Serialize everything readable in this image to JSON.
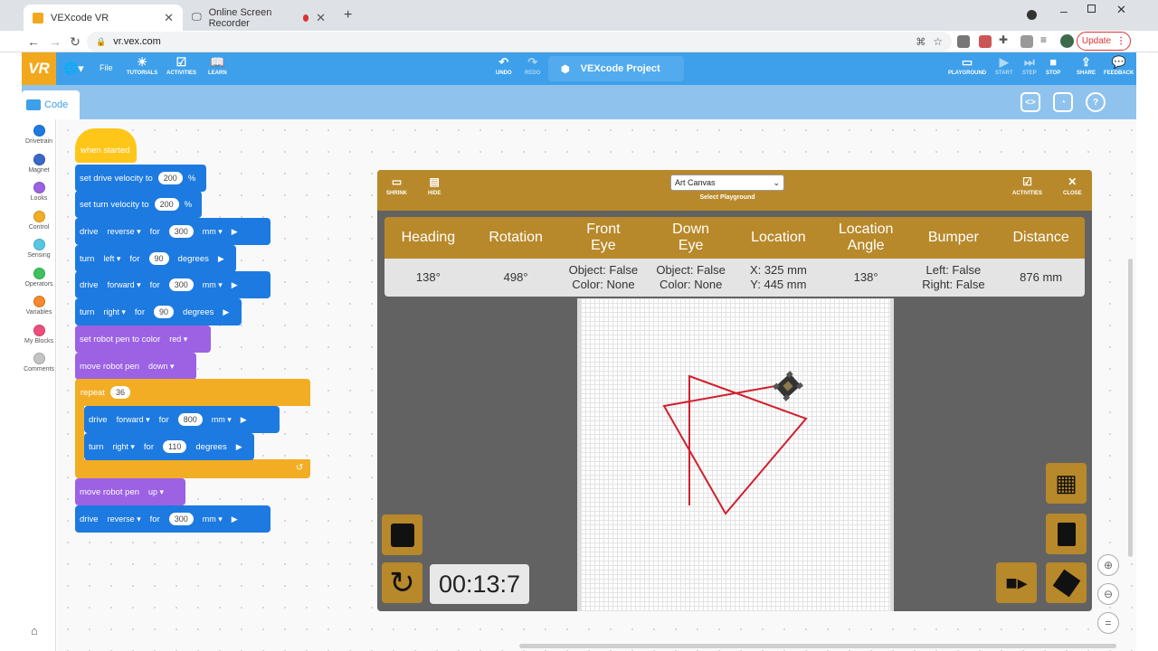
{
  "browser": {
    "tabs": [
      {
        "title": "VEXcode VR"
      },
      {
        "title": "Online Screen Recorder"
      }
    ],
    "url": "vr.vex.com",
    "update_label": "Update"
  },
  "vex": {
    "logo": "VR",
    "file_label": "File",
    "toolbar": {
      "tutorials": "TUTORIALS",
      "activities": "ACTIVITIES",
      "learn": "LEARN",
      "undo": "UNDO",
      "redo": "REDO",
      "playground": "PLAYGROUND",
      "start": "START",
      "step": "STEP",
      "stop": "STOP",
      "share": "SHARE",
      "feedback": "FEEDBACK"
    },
    "project_name": "VEXcode Project",
    "code_tab": "Code"
  },
  "categories": [
    {
      "label": "Drivetrain",
      "color": "#1d7ae0"
    },
    {
      "label": "Magnet",
      "color": "#3a67c9"
    },
    {
      "label": "Looks",
      "color": "#9c62e3"
    },
    {
      "label": "Control",
      "color": "#f2ad24"
    },
    {
      "label": "Sensing",
      "color": "#57c6e3"
    },
    {
      "label": "Operators",
      "color": "#3fc25a"
    },
    {
      "label": "Variables",
      "color": "#f5892b"
    },
    {
      "label": "My Blocks",
      "color": "#ee4d7e"
    },
    {
      "label": "Comments",
      "color": "#c4c4c4"
    }
  ],
  "blocks": {
    "hat": "when started",
    "b1": {
      "text": "set drive velocity to",
      "value": "200",
      "unit": "%"
    },
    "b2": {
      "text": "set turn velocity to",
      "value": "200",
      "unit": "%"
    },
    "b3": {
      "cmd": "drive",
      "dir": "reverse",
      "for": "for",
      "value": "300",
      "unit": "mm"
    },
    "b4": {
      "cmd": "turn",
      "dir": "left",
      "for": "for",
      "value": "90",
      "unit": "degrees"
    },
    "b5": {
      "cmd": "drive",
      "dir": "forward",
      "for": "for",
      "value": "300",
      "unit": "mm"
    },
    "b6": {
      "cmd": "turn",
      "dir": "right",
      "for": "for",
      "value": "90",
      "unit": "degrees"
    },
    "b7": {
      "text": "set robot pen to color",
      "value": "red"
    },
    "b8": {
      "text": "move robot pen",
      "value": "down"
    },
    "repeat": {
      "text": "repeat",
      "value": "36"
    },
    "b9": {
      "cmd": "drive",
      "dir": "forward",
      "for": "for",
      "value": "800",
      "unit": "mm"
    },
    "b10": {
      "cmd": "turn",
      "dir": "right",
      "for": "for",
      "value": "110",
      "unit": "degrees"
    },
    "b11": {
      "text": "move robot pen",
      "value": "up"
    },
    "b12": {
      "cmd": "drive",
      "dir": "reverse",
      "for": "for",
      "value": "300",
      "unit": "mm"
    }
  },
  "playground": {
    "shrink": "SHRINK",
    "hide": "HIDE",
    "selected": "Art Canvas",
    "select_label": "Select Playground",
    "activities": "ACTIVITIES",
    "close": "CLOSE",
    "timer": "00:13:7",
    "sensors": {
      "heading": {
        "label": "Heading",
        "value": "138°"
      },
      "rotation": {
        "label": "Rotation",
        "value": "498°"
      },
      "front_eye": {
        "label1": "Front",
        "label2": "Eye",
        "value1": "Object: False",
        "value2": "Color: None"
      },
      "down_eye": {
        "label1": "Down",
        "label2": "Eye",
        "value1": "Object: False",
        "value2": "Color: None"
      },
      "location": {
        "label": "Location",
        "value1": "X: 325 mm",
        "value2": "Y: 445 mm"
      },
      "location_angle": {
        "label1": "Location",
        "label2": "Angle",
        "value": "138°"
      },
      "bumper": {
        "label": "Bumper",
        "value1": "Left: False",
        "value2": "Right: False"
      },
      "distance": {
        "label": "Distance",
        "value": "876 mm"
      }
    },
    "pen_color": "#d0202e"
  }
}
